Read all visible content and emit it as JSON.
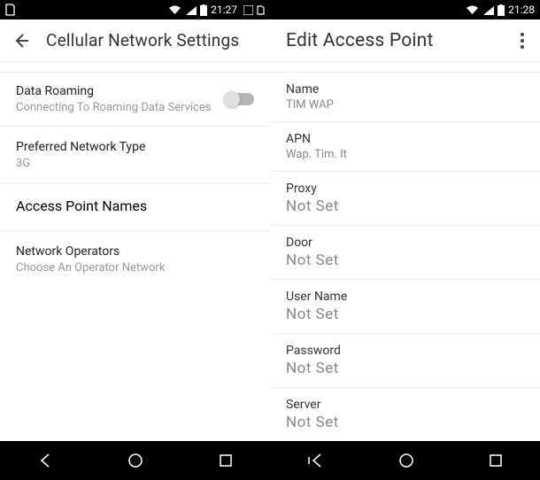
{
  "left": {
    "status": {
      "time": "21:27"
    },
    "header": {
      "title": "Cellular Network Settings"
    },
    "roaming": {
      "title": "Data Roaming",
      "sub": "Connecting To Roaming Data Services"
    },
    "network_type": {
      "title": "Preferred Network Type",
      "value": "3G"
    },
    "apn": {
      "title": "Access Point Names"
    },
    "operators": {
      "title": "Network Operators",
      "sub": "Choose An Operator Network"
    }
  },
  "right": {
    "status": {
      "time": "21:28"
    },
    "header": {
      "title": "Edit Access Point"
    },
    "fields": {
      "name": {
        "label": "Name",
        "value": "TIM WAP"
      },
      "apn": {
        "label": "APN",
        "value": "Wap. Tim. It"
      },
      "proxy": {
        "label": "Proxy",
        "value": "Not Set"
      },
      "door": {
        "label": "Door",
        "value": "Not Set"
      },
      "username": {
        "label": "User Name",
        "value": "Not Set"
      },
      "password": {
        "label": "Password",
        "value": "Not Set"
      },
      "server": {
        "label": "Server",
        "value": "Not Set"
      }
    }
  }
}
